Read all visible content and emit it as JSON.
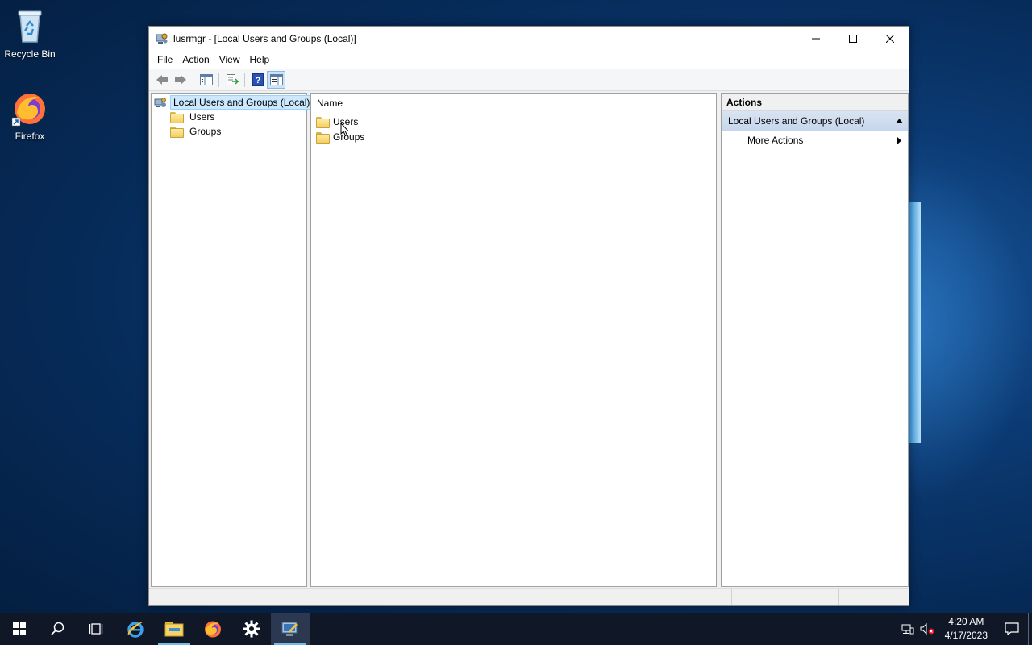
{
  "desktop": {
    "icons": [
      {
        "label": "Recycle Bin",
        "icon": "recycle-bin-icon"
      },
      {
        "label": "Firefox",
        "icon": "firefox-icon"
      }
    ]
  },
  "window": {
    "title": "lusrmgr - [Local Users and Groups (Local)]",
    "menu": {
      "file": "File",
      "action": "Action",
      "view": "View",
      "help": "Help"
    },
    "tree": {
      "root": "Local Users and Groups (Local)",
      "children": [
        "Users",
        "Groups"
      ]
    },
    "list": {
      "column_name": "Name",
      "items": [
        "Users",
        "Groups"
      ]
    },
    "actions": {
      "header": "Actions",
      "section": "Local Users and Groups (Local)",
      "more_actions": "More Actions"
    }
  },
  "taskbar": {
    "time": "4:20 AM",
    "date": "4/17/2023"
  },
  "colors": {
    "selection": "#cce8ff",
    "actions_section": "#c6d6ec",
    "taskbar": "#101828",
    "folder": "#f2cf64"
  }
}
